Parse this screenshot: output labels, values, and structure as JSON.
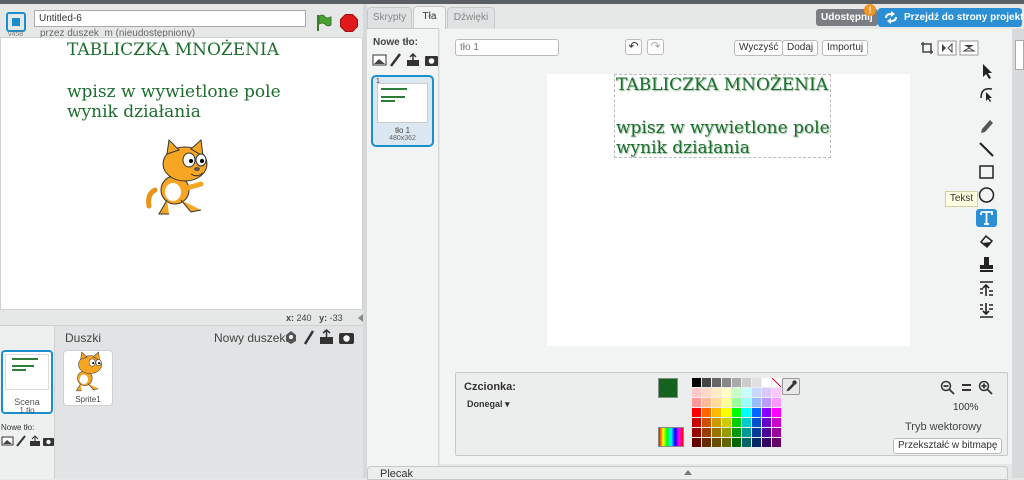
{
  "header": {
    "version": "v458",
    "project_title": "Untitled-6",
    "author": "przez duszek_m (nieudostępniony)",
    "share_label": "Udostępnij",
    "notice_badge": "!",
    "project_page_label": "Przejdź do strony projektu"
  },
  "stage": {
    "title_text": "TABLICZKA MNOŻENIA",
    "line1": "wpisz w wywietlone pole",
    "line2": "wynik działania",
    "x_label": "x:",
    "x_value": "240",
    "y_label": "y:",
    "y_value": "-33"
  },
  "sprites_pane": {
    "scene_label": "Scena",
    "scene_sub": "1 tło",
    "new_backdrop_label": "Nowe tło:",
    "sprites_header": "Duszki",
    "new_sprite_label": "Nowy duszek:",
    "sprites": [
      {
        "name": "Sprite1"
      }
    ]
  },
  "tabs": [
    {
      "label": "Skrypty",
      "active": false
    },
    {
      "label": "Tła",
      "active": true
    },
    {
      "label": "Dźwięki",
      "active": false
    }
  ],
  "backdrop_list": {
    "new_label": "Nowe tło:",
    "items": [
      {
        "index": "1",
        "name": "tło 1",
        "size": "480x362"
      }
    ]
  },
  "editor": {
    "costume_name": "tło 1",
    "clear_label": "Wyczyść",
    "add_label": "Dodaj",
    "import_label": "Importuj",
    "tooltip": "Tekst",
    "canvas_title": "TABLICZKA MNOŻENIA",
    "canvas_line1": "wpisz w wywietlone pole",
    "canvas_line2": "wynik działania",
    "font_label": "Czcionka:",
    "font_value": "Donegal ▾",
    "zoom": "100%",
    "mode_label": "Tryb wektorowy",
    "convert_label": "Przekształć w bitmapę",
    "primary_color": "#16621f",
    "secondary_color": "#ffffff"
  },
  "backpack": {
    "label": "Plecak"
  },
  "icons": {
    "logo": "scratch-logo-icon",
    "flag": "green-flag-icon",
    "stop": "stop-icon",
    "tools": [
      "select-icon",
      "reshape-icon",
      "pencil-icon",
      "line-icon",
      "rectangle-icon",
      "ellipse-icon",
      "text-icon",
      "fill-icon",
      "stamp-icon",
      "forward-layer-icon",
      "back-layer-icon"
    ]
  },
  "palette": [
    [
      "#000000",
      "#444444",
      "#666666",
      "#888888",
      "#aaaaaa",
      "#cccccc",
      "#e0e0e0",
      "#ffffff",
      "none"
    ],
    [
      "#ffc7c7",
      "#ffd9c7",
      "#ffecc7",
      "#ffffc7",
      "#c7ffc7",
      "#c7ffff",
      "#c7d9ff",
      "#d9c7ff",
      "#ffc7ff"
    ],
    [
      "#ff9999",
      "#ffbb99",
      "#ffdd99",
      "#ffff99",
      "#99ff99",
      "#99ffff",
      "#99bbff",
      "#bb99ff",
      "#ff99ff"
    ],
    [
      "#ff0000",
      "#ff6600",
      "#ffbb00",
      "#ffff00",
      "#00ff00",
      "#00ffff",
      "#0066ff",
      "#8800ff",
      "#ff00ff"
    ],
    [
      "#cc0000",
      "#cc5200",
      "#cc9900",
      "#cccc00",
      "#00cc00",
      "#00cccc",
      "#0052cc",
      "#6600cc",
      "#cc00cc"
    ],
    [
      "#990000",
      "#993d00",
      "#997300",
      "#999900",
      "#009900",
      "#009999",
      "#003d99",
      "#4d0099",
      "#990099"
    ],
    [
      "#660000",
      "#662900",
      "#664d00",
      "#666600",
      "#006600",
      "#006666",
      "#002966",
      "#330066",
      "#660066"
    ]
  ]
}
